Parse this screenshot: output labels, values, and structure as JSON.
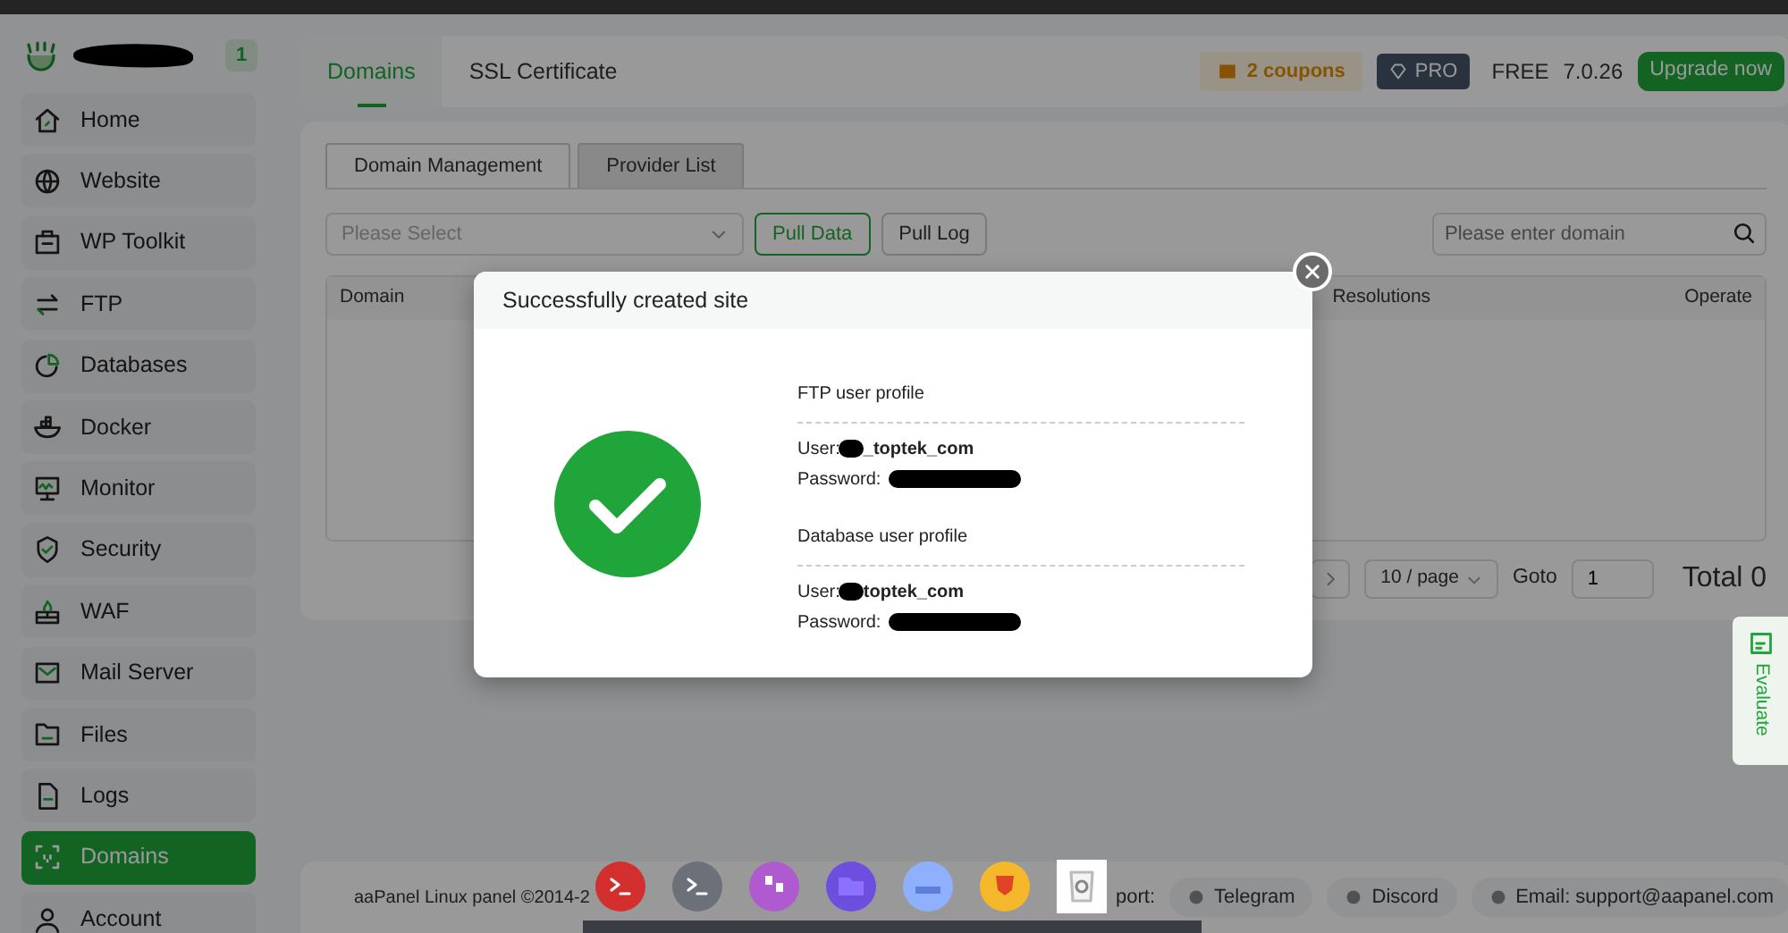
{
  "sidebar": {
    "badge": "1",
    "items": [
      {
        "label": "Home",
        "selected": false
      },
      {
        "label": "Website",
        "selected": false
      },
      {
        "label": "WP Toolkit",
        "selected": false
      },
      {
        "label": "FTP",
        "selected": false
      },
      {
        "label": "Databases",
        "selected": false
      },
      {
        "label": "Docker",
        "selected": false
      },
      {
        "label": "Monitor",
        "selected": false
      },
      {
        "label": "Security",
        "selected": false
      },
      {
        "label": "WAF",
        "selected": false
      },
      {
        "label": "Mail Server",
        "selected": false
      },
      {
        "label": "Files",
        "selected": false
      },
      {
        "label": "Logs",
        "selected": false
      },
      {
        "label": "Domains",
        "selected": true
      },
      {
        "label": "Account",
        "selected": false
      }
    ]
  },
  "header": {
    "tabs": [
      {
        "label": "Domains",
        "selected": true
      },
      {
        "label": "SSL Certificate",
        "selected": false
      }
    ],
    "coupons": "2 coupons",
    "pro": "PRO",
    "edition": "FREE",
    "version": "7.0.26",
    "upgrade": "Upgrade now"
  },
  "content": {
    "tabs": [
      {
        "label": "Domain Management",
        "selected": true
      },
      {
        "label": "Provider List",
        "selected": false
      }
    ],
    "select_placeholder": "Please Select",
    "buttons": [
      {
        "label": "Pull Data",
        "kind": "primary"
      },
      {
        "label": "Pull Log",
        "kind": "default"
      }
    ],
    "search_placeholder": "Please enter domain",
    "table": {
      "columns": [
        "Domain",
        "Resolutions",
        "Operate"
      ]
    },
    "pagination": {
      "page_size": "10 / page",
      "goto_label": "Goto",
      "page_input": "1",
      "total": "Total 0"
    }
  },
  "modal": {
    "title": "Successfully created site",
    "sections": [
      {
        "heading": "FTP user profile",
        "fields": [
          {
            "label": "User:",
            "redacted": true,
            "value": "_toptek_com"
          },
          {
            "label": "Password:",
            "redacted": true
          }
        ]
      },
      {
        "heading": "Database user profile",
        "fields": [
          {
            "label": "User:",
            "redacted": true,
            "value": "toptek_com"
          },
          {
            "label": "Password:",
            "redacted": true
          }
        ]
      }
    ]
  },
  "evaluate": "Evaluate",
  "footer": {
    "copyright": "aaPanel Linux panel ©2014-2",
    "support_label": "port:",
    "links": [
      {
        "label": "Telegram"
      },
      {
        "label": "Discord"
      },
      {
        "label": "Email: support@aapanel.com"
      }
    ]
  },
  "dock": {
    "apps": [
      {
        "kind": "terminal",
        "color": "#d42f2f"
      },
      {
        "kind": "terminal",
        "color": "#6b7079"
      },
      {
        "kind": "quote",
        "color": "#b05ad0"
      },
      {
        "kind": "folder",
        "color": "#6d4fe0"
      },
      {
        "kind": "drive",
        "color": "#8fb0ff"
      },
      {
        "kind": "lion",
        "color": "#f5b82a"
      },
      {
        "kind": "trash",
        "color": "#ffffff"
      }
    ]
  }
}
